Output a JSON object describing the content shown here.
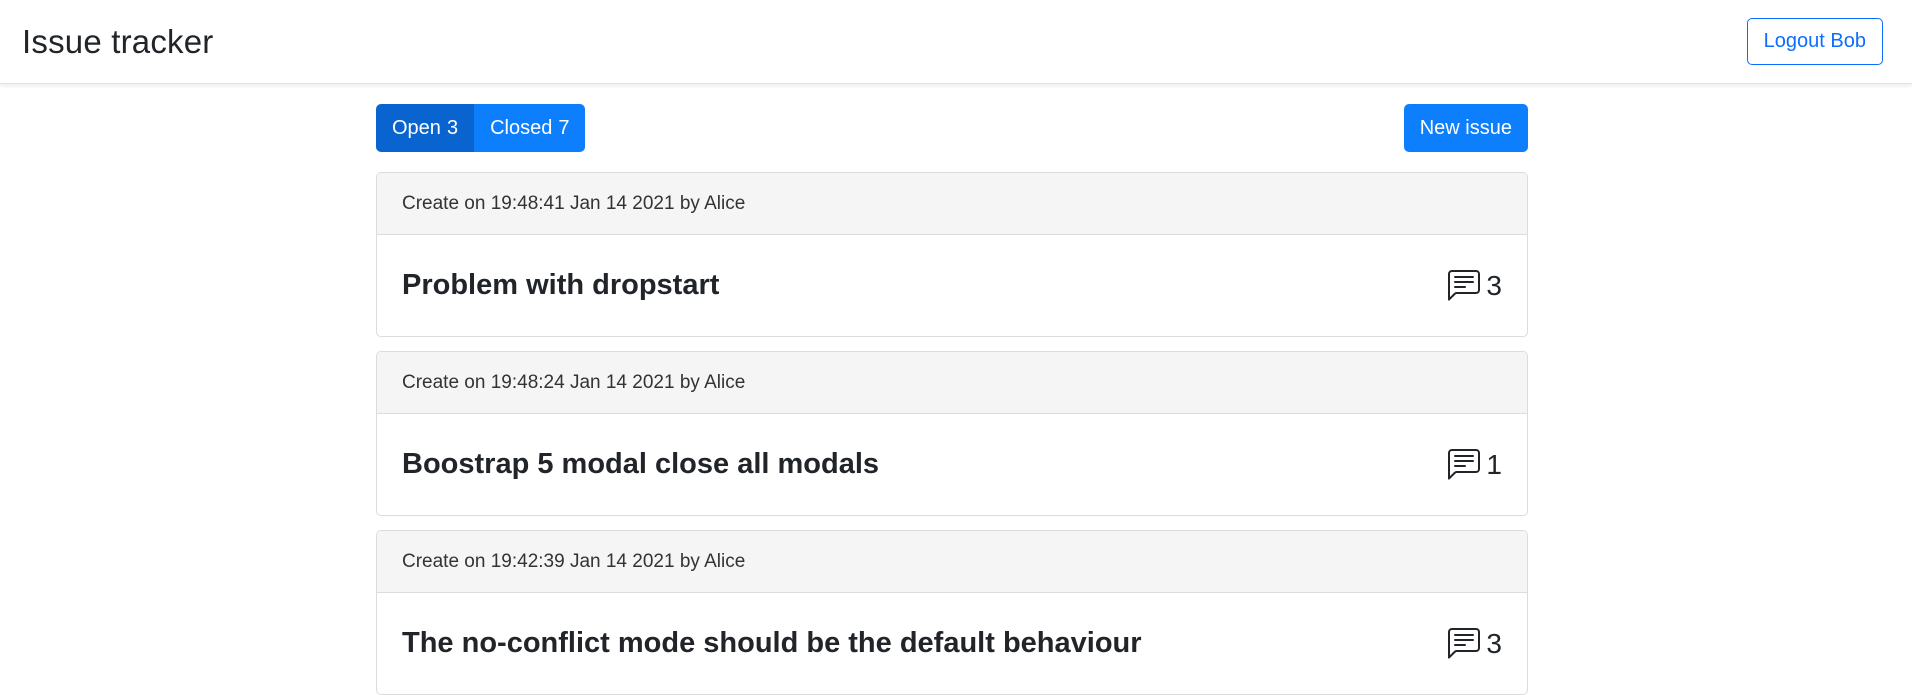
{
  "header": {
    "title": "Issue tracker",
    "logout_label": "Logout Bob"
  },
  "filters": {
    "open_label": "Open",
    "open_count": "3",
    "closed_label": "Closed",
    "closed_count": "7"
  },
  "new_issue_label": "New issue",
  "issues": [
    {
      "meta": "Create on 19:48:41 Jan 14 2021 by Alice",
      "title": "Problem with dropstart",
      "comments": "3"
    },
    {
      "meta": "Create on 19:48:24 Jan 14 2021 by Alice",
      "title": "Boostrap 5 modal close all modals",
      "comments": "1"
    },
    {
      "meta": "Create on 19:42:39 Jan 14 2021 by Alice",
      "title": "The no-conflict mode should be the default behaviour",
      "comments": "3"
    }
  ],
  "colors": {
    "primary": "#0d7ffc",
    "primary_active": "#0a64d0",
    "outline": "#0d6efd"
  },
  "icons": {
    "comments": "chat-left-text-icon"
  }
}
